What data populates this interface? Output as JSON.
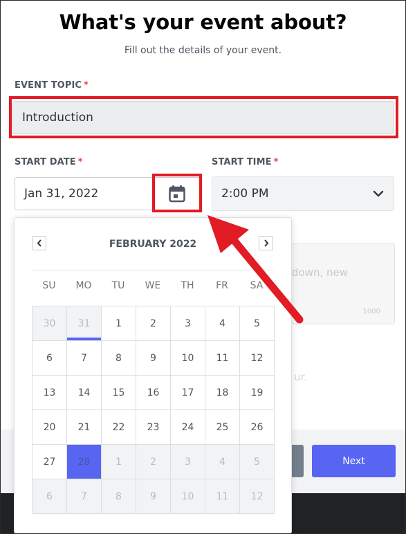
{
  "modal": {
    "title": "What's your event about?",
    "subtitle": "Fill out the details of your event."
  },
  "topic": {
    "label": "EVENT TOPIC",
    "required_mark": "*",
    "value": "Introduction"
  },
  "start_date": {
    "label": "START DATE",
    "required_mark": "*",
    "value": "Jan 31, 2022",
    "icon": "calendar-icon"
  },
  "start_time": {
    "label": "START TIME",
    "required_mark": "*",
    "value": "2:00 PM",
    "icon": "chevron-down-icon"
  },
  "background": {
    "description_partial": "down, new",
    "counter_partial": "1000",
    "text_partial": "ur.",
    "next_label": "Next"
  },
  "calendar": {
    "month_label": "FEBRUARY 2022",
    "prev_icon": "chevron-left-icon",
    "next_icon": "chevron-right-icon",
    "weekdays": [
      "SU",
      "MO",
      "TU",
      "WE",
      "TH",
      "FR",
      "SA"
    ],
    "weeks": [
      [
        "30",
        "31",
        "1",
        "2",
        "3",
        "4",
        "5"
      ],
      [
        "6",
        "7",
        "8",
        "9",
        "10",
        "11",
        "12"
      ],
      [
        "13",
        "14",
        "15",
        "16",
        "17",
        "18",
        "19"
      ],
      [
        "20",
        "21",
        "22",
        "23",
        "24",
        "25",
        "26"
      ],
      [
        "27",
        "28",
        "1",
        "2",
        "3",
        "4",
        "5"
      ],
      [
        "6",
        "7",
        "8",
        "9",
        "10",
        "11",
        "12"
      ]
    ]
  },
  "colors": {
    "annotation": "#e11c24",
    "accent": "#5865f2"
  }
}
